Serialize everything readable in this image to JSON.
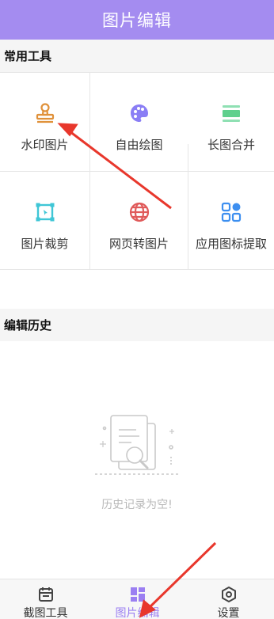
{
  "header": {
    "title": "图片编辑"
  },
  "sections": {
    "tools_title": "常用工具",
    "history_title": "编辑历史"
  },
  "tools": [
    {
      "label": "水印图片",
      "icon": "stamp-icon",
      "color": "#e0913a"
    },
    {
      "label": "自由绘图",
      "icon": "palette-icon",
      "color": "#8a7ef5"
    },
    {
      "label": "长图合并",
      "icon": "merge-icon",
      "color": "#6fd49a"
    },
    {
      "label": "图片裁剪",
      "icon": "crop-icon",
      "color": "#3fc6d6"
    },
    {
      "label": "网页转图片",
      "icon": "globe-icon",
      "color": "#e05a5a"
    },
    {
      "label": "应用图标提取",
      "icon": "grid-icon",
      "color": "#3d8ff0"
    }
  ],
  "history": {
    "empty_text": "历史记录为空!"
  },
  "tabbar": {
    "items": [
      {
        "label": "截图工具",
        "icon": "calendar-icon",
        "active": false
      },
      {
        "label": "图片编辑",
        "icon": "apps-icon",
        "active": true
      },
      {
        "label": "设置",
        "icon": "settings-icon",
        "active": false
      }
    ],
    "accent": "#9b7ff2"
  },
  "colors": {
    "header_bg": "#a48cf0",
    "annotation_arrow": "#e8372c"
  }
}
